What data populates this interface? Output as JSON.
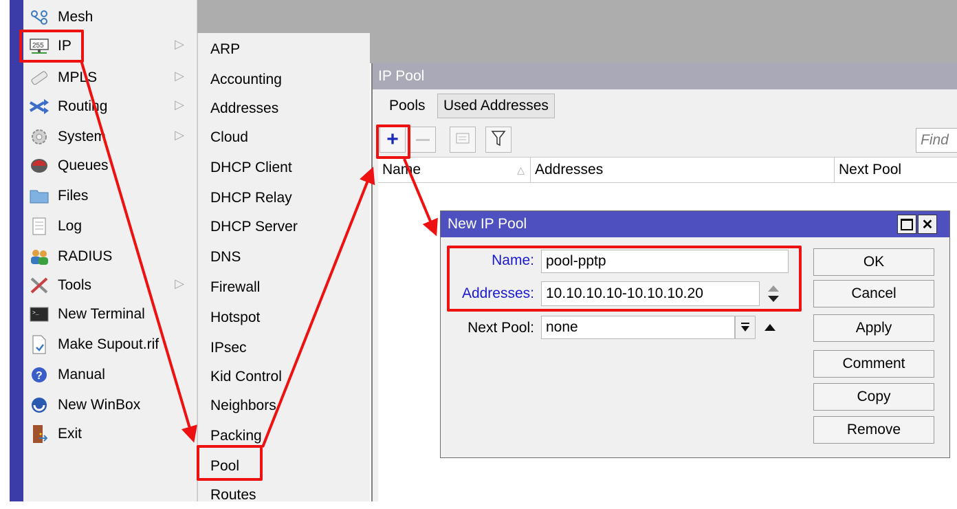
{
  "main_menu": {
    "items": [
      {
        "label": "Mesh",
        "icon": "mesh-icon"
      },
      {
        "label": "IP",
        "icon": "ip-255-icon",
        "submenu": true
      },
      {
        "label": "MPLS",
        "icon": "mpls-icon",
        "submenu": true
      },
      {
        "label": "Routing",
        "icon": "routing-icon",
        "submenu": true
      },
      {
        "label": "System",
        "icon": "system-gear-icon",
        "submenu": true
      },
      {
        "label": "Queues",
        "icon": "queues-icon"
      },
      {
        "label": "Files",
        "icon": "folder-icon"
      },
      {
        "label": "Log",
        "icon": "log-icon"
      },
      {
        "label": "RADIUS",
        "icon": "radius-users-icon"
      },
      {
        "label": "Tools",
        "icon": "tools-icon",
        "submenu": true
      },
      {
        "label": "New Terminal",
        "icon": "terminal-icon"
      },
      {
        "label": "Make Supout.rif",
        "icon": "supout-file-icon"
      },
      {
        "label": "Manual",
        "icon": "help-icon"
      },
      {
        "label": "New WinBox",
        "icon": "winbox-icon"
      },
      {
        "label": "Exit",
        "icon": "exit-door-icon"
      }
    ]
  },
  "ip_submenu": {
    "items": [
      "ARP",
      "Accounting",
      "Addresses",
      "Cloud",
      "DHCP Client",
      "DHCP Relay",
      "DHCP Server",
      "DNS",
      "Firewall",
      "Hotspot",
      "IPsec",
      "Kid Control",
      "Neighbors",
      "Packing",
      "Pool",
      "Routes"
    ]
  },
  "pool_window": {
    "title": "IP Pool",
    "tabs": [
      "Pools",
      "Used Addresses"
    ],
    "find_placeholder": "Find",
    "columns": [
      "Name",
      "Addresses",
      "Next Pool"
    ]
  },
  "dialog": {
    "title": "New IP Pool",
    "name_label": "Name:",
    "name_value": "pool-pptp",
    "addresses_label": "Addresses:",
    "addresses_value": "10.10.10.10-10.10.10.20",
    "next_pool_label": "Next Pool:",
    "next_pool_value": "none",
    "buttons": [
      "OK",
      "Cancel",
      "Apply",
      "Comment",
      "Copy",
      "Remove"
    ]
  },
  "colors": {
    "menu_strip": "#3c3ca8",
    "dialog_title_bar": "#4e50c0",
    "highlight_red": "#ee1111",
    "field_label_blue": "#1a1ad0"
  }
}
